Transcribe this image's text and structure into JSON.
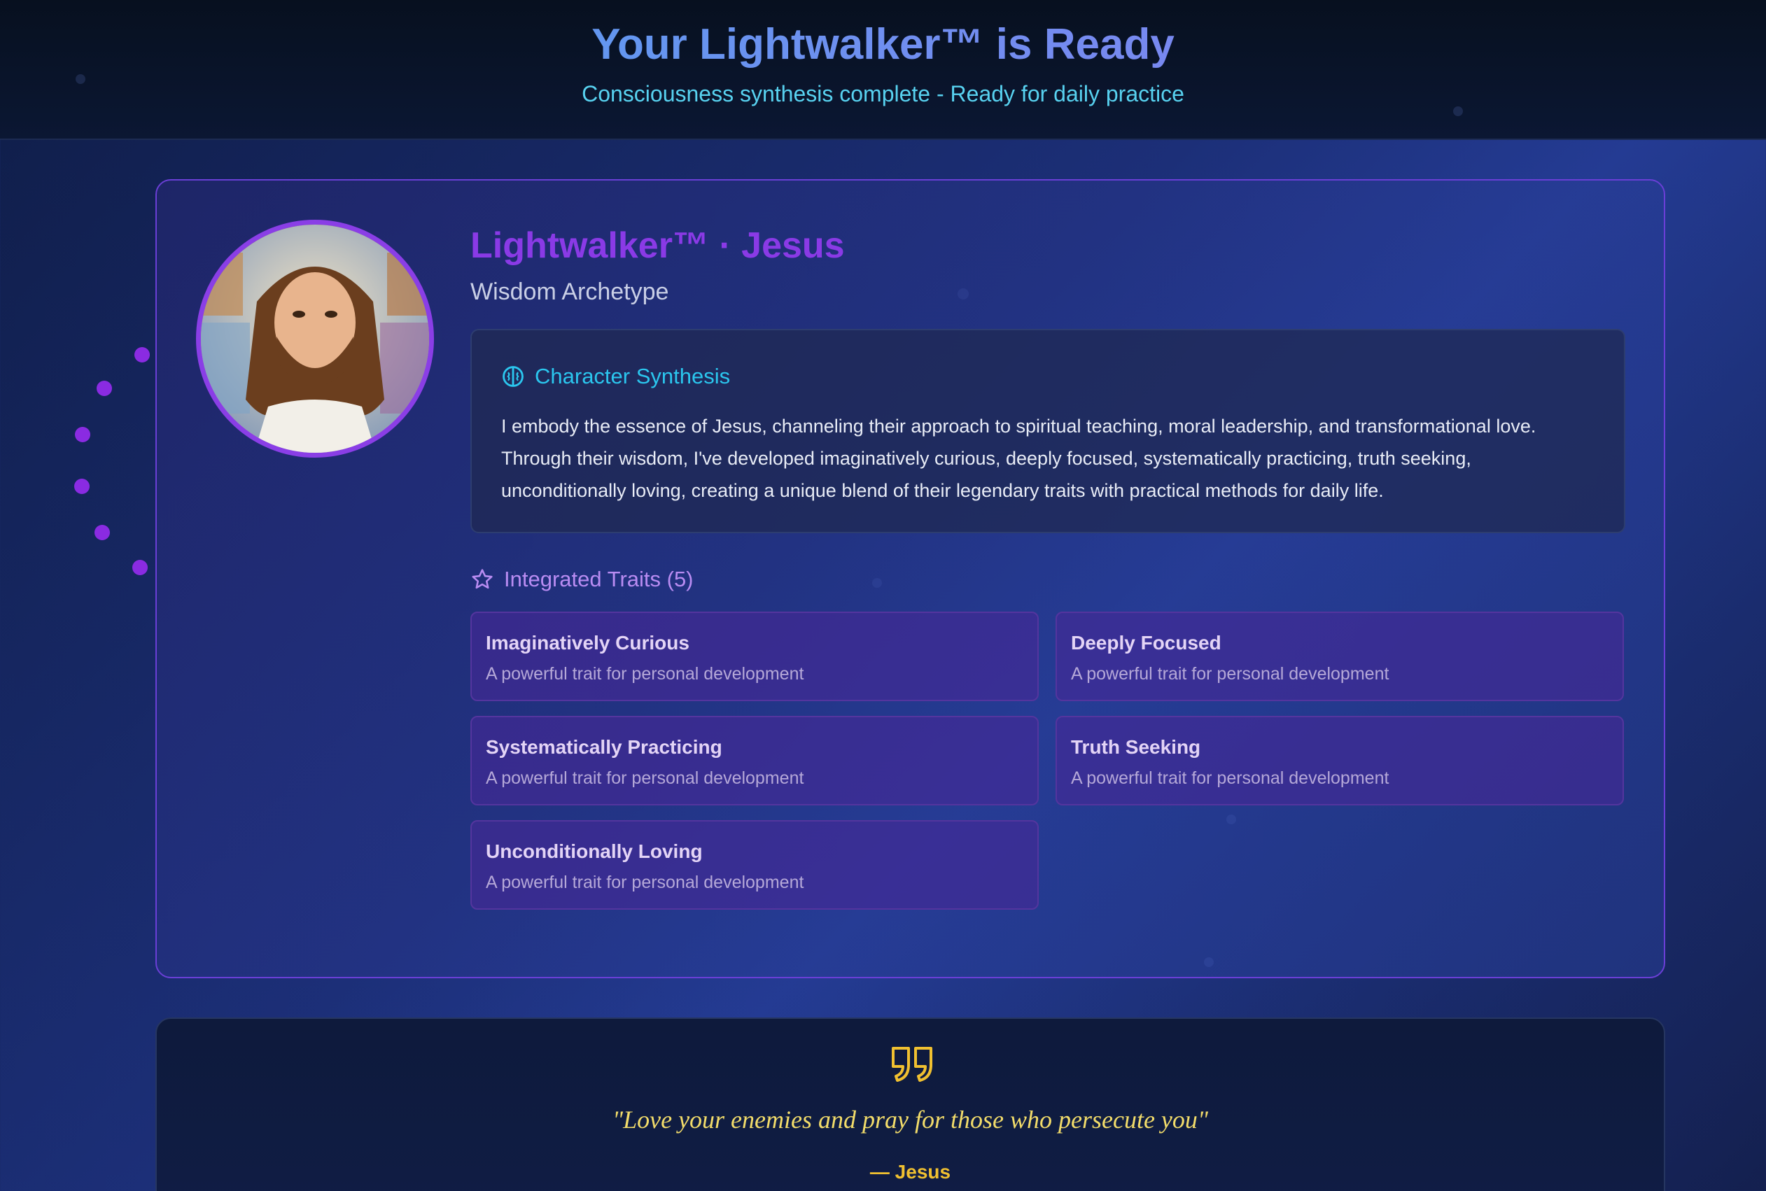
{
  "header": {
    "title": "Your Lightwalker™ is Ready",
    "subtitle": "Consciousness synthesis complete - Ready for daily practice"
  },
  "profile": {
    "name": "Lightwalker™ · Jesus",
    "archetype": "Wisdom Archetype",
    "avatar_icon": "portrait-jesus",
    "accent_color": "#8a3ae6"
  },
  "synthesis": {
    "icon": "brain-icon",
    "heading": "Character Synthesis",
    "body": "I embody the essence of Jesus, channeling their approach to spiritual teaching, moral leadership, and transformational love. Through their wisdom, I've developed imaginatively curious, deeply focused, systematically practicing, truth seeking, unconditionally loving, creating a unique blend of their legendary traits with practical methods for daily life."
  },
  "traits": {
    "icon": "star-icon",
    "heading": "Integrated Traits (5)",
    "items": [
      {
        "title": "Imaginatively Curious",
        "desc": "A powerful trait for personal development"
      },
      {
        "title": "Deeply Focused",
        "desc": "A powerful trait for personal development"
      },
      {
        "title": "Systematically Practicing",
        "desc": "A powerful trait for personal development"
      },
      {
        "title": "Truth Seeking",
        "desc": "A powerful trait for personal development"
      },
      {
        "title": "Unconditionally Loving",
        "desc": "A powerful trait for personal development"
      }
    ]
  },
  "quote": {
    "icon": "quote-icon",
    "text": "\"Love your enemies and pray for those who persecute you\"",
    "author": "— Jesus",
    "color": "#f2dc6a"
  }
}
